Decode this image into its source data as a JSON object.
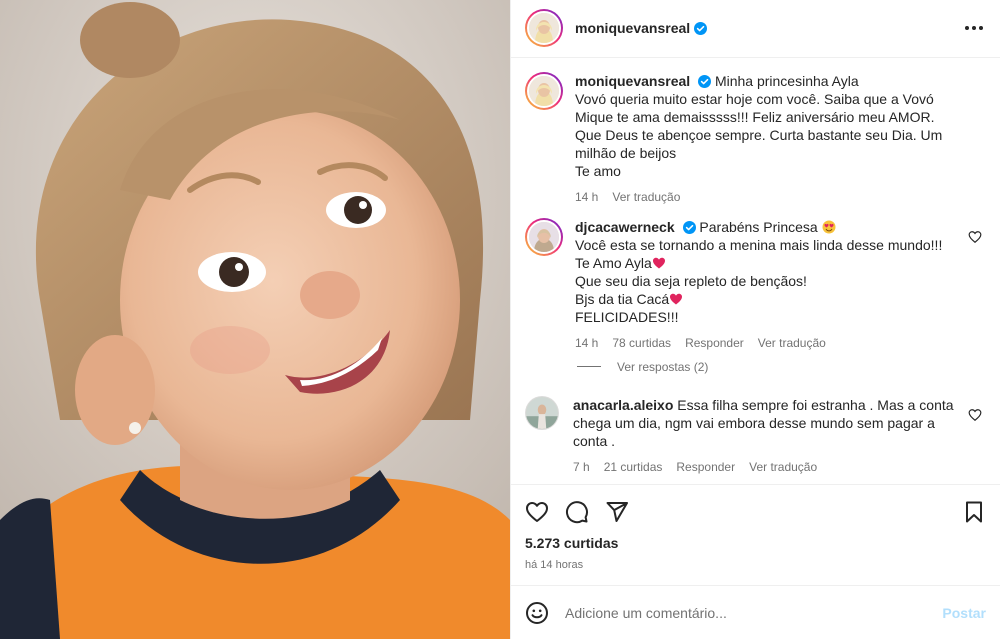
{
  "post": {
    "author": "moniquevansreal",
    "verified": true,
    "more_icon": "more-horizontal-icon"
  },
  "caption": {
    "author": "moniquevansreal",
    "lines": [
      "Minha princesinha Ayla",
      "Vovó queria muito estar hoje com você. Saiba que a Vovó Mique te ama demaisssss!!! Feliz aniversário meu AMOR. Que Deus te abençoe sempre. Curta bastante seu Dia. Um milhão de beijos",
      "Te amo"
    ],
    "time": "14 h",
    "translate": "Ver tradução"
  },
  "comments": [
    {
      "author": "djcacawerneck",
      "verified": true,
      "lines": [
        "Parabéns Princesa",
        "Você esta se tornando a menina mais linda desse mundo!!!",
        "Te Amo Ayla",
        "Que seu dia seja repleto de bençãos!",
        "Bjs da tia Cacá",
        "FELICIDADES!!!"
      ],
      "time": "14 h",
      "likes": "78 curtidas",
      "reply": "Responder",
      "translate": "Ver tradução",
      "view_replies": "Ver respostas (2)"
    },
    {
      "author": "anacarla.aleixo",
      "verified": false,
      "text": "Essa filha sempre foi estranha . Mas a conta chega um dia, ngm vai embora desse mundo sem pagar a conta .",
      "time": "7 h",
      "likes": "21 curtidas",
      "reply": "Responder",
      "translate": "Ver tradução"
    }
  ],
  "actions": {
    "like_icon": "heart-icon",
    "comment_icon": "comment-icon",
    "share_icon": "send-icon",
    "save_icon": "bookmark-icon"
  },
  "stats": {
    "likes": "5.273 curtidas",
    "time": "há 14 horas"
  },
  "composer": {
    "placeholder": "Adicione um comentário...",
    "post_label": "Postar",
    "emoji_icon": "smiley-icon"
  },
  "colors": {
    "text": "#262626",
    "muted": "#737373",
    "verified": "#0095f6",
    "post_disabled": "#b2dffc",
    "heart_emoji": "#e0245e"
  }
}
